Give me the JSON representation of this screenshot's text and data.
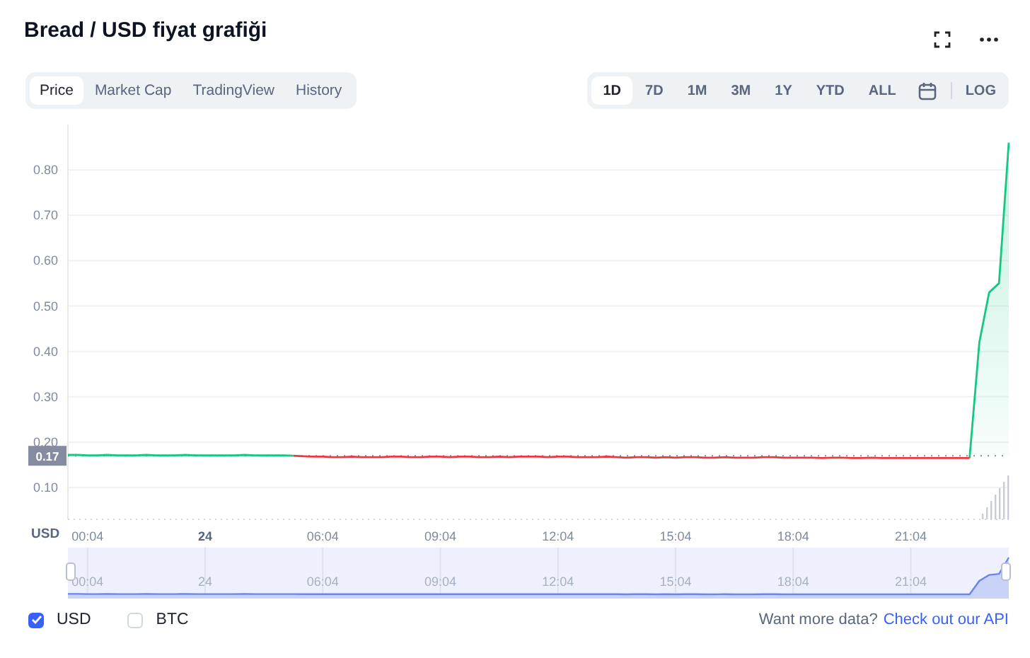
{
  "title": "Bread / USD fiyat grafiği",
  "tabs": [
    {
      "label": "Price",
      "selected": true
    },
    {
      "label": "Market Cap",
      "selected": false
    },
    {
      "label": "TradingView",
      "selected": false
    },
    {
      "label": "History",
      "selected": false
    }
  ],
  "ranges": [
    {
      "label": "1D",
      "selected": true
    },
    {
      "label": "7D",
      "selected": false
    },
    {
      "label": "1M",
      "selected": false
    },
    {
      "label": "3M",
      "selected": false
    },
    {
      "label": "1Y",
      "selected": false
    },
    {
      "label": "YTD",
      "selected": false
    },
    {
      "label": "ALL",
      "selected": false
    }
  ],
  "log_button": "LOG",
  "chart_data": {
    "type": "line",
    "ylabel": "USD",
    "ylim": [
      0.03,
      0.9
    ],
    "grid": true,
    "ref_lines": [
      {
        "axis": "y",
        "value": 0.17
      }
    ],
    "yticks": [
      {
        "value": 0.1,
        "label": "0.10"
      },
      {
        "value": 0.2,
        "label": "0.20"
      },
      {
        "value": 0.3,
        "label": "0.30"
      },
      {
        "value": 0.4,
        "label": "0.40"
      },
      {
        "value": 0.5,
        "label": "0.50"
      },
      {
        "value": 0.6,
        "label": "0.60"
      },
      {
        "value": 0.7,
        "label": "0.70"
      },
      {
        "value": 0.8,
        "label": "0.80"
      }
    ],
    "categories": [
      null,
      null,
      "00:04",
      null,
      null,
      null,
      null,
      null,
      null,
      null,
      null,
      null,
      null,
      null,
      "24",
      null,
      null,
      null,
      null,
      null,
      null,
      null,
      null,
      null,
      null,
      null,
      "06:04",
      null,
      null,
      null,
      null,
      null,
      null,
      null,
      null,
      null,
      null,
      null,
      "09:04",
      null,
      null,
      null,
      null,
      null,
      null,
      null,
      null,
      null,
      null,
      null,
      "12:04",
      null,
      null,
      null,
      null,
      null,
      null,
      null,
      null,
      null,
      null,
      null,
      "15:04",
      null,
      null,
      null,
      null,
      null,
      null,
      null,
      null,
      null,
      null,
      null,
      "18:04",
      null,
      null,
      null,
      null,
      null,
      null,
      null,
      null,
      null,
      null,
      null,
      "21:04",
      null,
      null,
      null,
      null,
      null,
      null,
      null,
      null,
      null,
      null
    ],
    "series": [
      {
        "color": "#16c784",
        "values": [
          0.172,
          0.172,
          0.171,
          0.171,
          0.172,
          0.171,
          0.171,
          0.171,
          0.172,
          0.171,
          0.171,
          0.171,
          0.172,
          0.171,
          0.171,
          0.171,
          0.171,
          0.171,
          0.172,
          0.171,
          0.171,
          0.171,
          0.171,
          0.17,
          null,
          null,
          null,
          null,
          null,
          null,
          null,
          null,
          null,
          null,
          null,
          null,
          null,
          null,
          null,
          null,
          null,
          null,
          null,
          null,
          null,
          null,
          null,
          null,
          null,
          null,
          null,
          null,
          null,
          null,
          null,
          null,
          null,
          null,
          null,
          null,
          null,
          null,
          null,
          null,
          null,
          null,
          null,
          null,
          null,
          null,
          null,
          null,
          null,
          null,
          null,
          null,
          null,
          null,
          null,
          null,
          null,
          null,
          null,
          null,
          null,
          null,
          null,
          null,
          null,
          null,
          null,
          null,
          0.165,
          0.42,
          0.53,
          0.55,
          0.86
        ]
      },
      {
        "color": "#ea3943",
        "values": [
          null,
          null,
          null,
          null,
          null,
          null,
          null,
          null,
          null,
          null,
          null,
          null,
          null,
          null,
          null,
          null,
          null,
          null,
          null,
          null,
          null,
          null,
          null,
          0.17,
          0.169,
          0.168,
          0.168,
          0.167,
          0.167,
          0.168,
          0.167,
          0.167,
          0.167,
          0.168,
          0.168,
          0.167,
          0.167,
          0.168,
          0.168,
          0.167,
          0.168,
          0.168,
          0.167,
          0.167,
          0.168,
          0.167,
          0.168,
          0.168,
          0.168,
          0.167,
          0.168,
          0.168,
          0.167,
          0.167,
          0.167,
          0.168,
          0.167,
          0.166,
          0.167,
          0.167,
          0.166,
          0.167,
          0.166,
          0.167,
          0.167,
          0.166,
          0.166,
          0.167,
          0.166,
          0.166,
          0.166,
          0.167,
          0.167,
          0.166,
          0.166,
          0.166,
          0.166,
          0.165,
          0.166,
          0.166,
          0.165,
          0.165,
          0.166,
          0.165,
          0.165,
          0.165,
          0.165,
          0.165,
          0.165,
          0.165,
          0.165,
          0.165,
          0.165,
          null,
          null,
          null,
          null
        ]
      }
    ],
    "annotations": [
      {
        "y": 0.17,
        "text": "0.17"
      }
    ]
  },
  "navigator": {
    "xticks": [
      "00:04",
      "24",
      "06:04",
      "09:04",
      "12:04",
      "15:04",
      "18:04",
      "21:04"
    ]
  },
  "currencies": [
    {
      "label": "USD",
      "checked": true
    },
    {
      "label": "BTC",
      "checked": false
    }
  ],
  "more_data": {
    "text": "Want more data?",
    "link": "Check out our API"
  }
}
